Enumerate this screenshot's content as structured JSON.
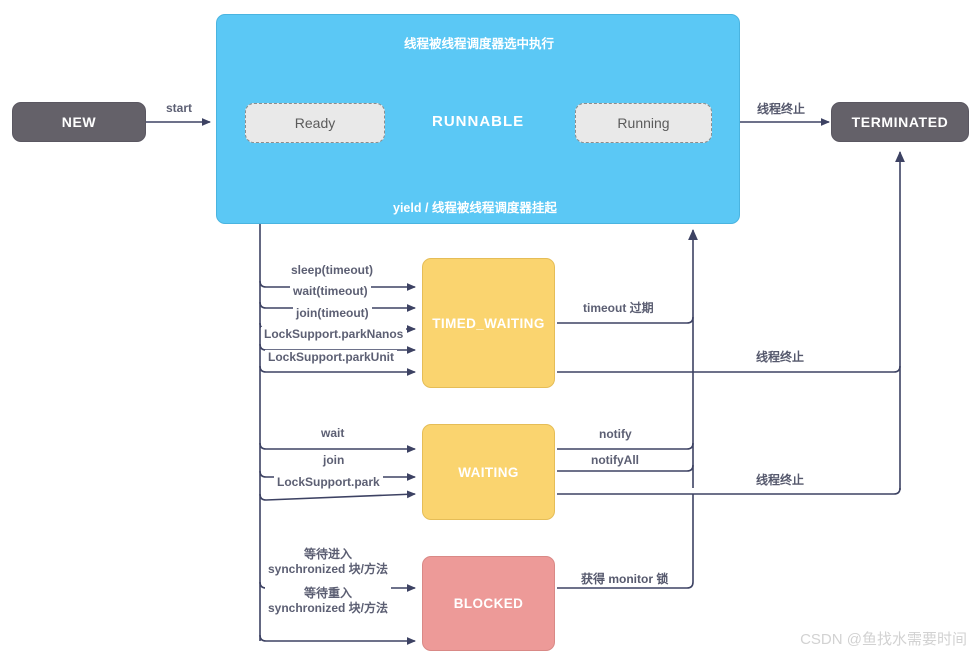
{
  "diagram": {
    "title": "Java Thread State Diagram",
    "colors": {
      "terminal": "#646169",
      "runnable": "#5BC8F5",
      "sub_state": "#e9e9e9",
      "waiting": "#FAD46F",
      "blocked": "#ED9A98",
      "edge": "#3d4263"
    }
  },
  "nodes": {
    "new": "NEW",
    "terminated": "TERMINATED",
    "runnable": "RUNNABLE",
    "ready": "Ready",
    "running": "Running",
    "timed_waiting": "TIMED_WAITING",
    "waiting": "WAITING",
    "blocked": "BLOCKED"
  },
  "runnable_band": {
    "top_label": "线程被线程调度器选中执行",
    "bottom_label": "yield / 线程被线程调度器挂起"
  },
  "edges": {
    "start": "start",
    "terminate_top": "线程终止",
    "terminate_timed": "线程终止",
    "terminate_waiting": "线程终止",
    "timed_in": [
      "sleep(timeout)",
      "wait(timeout)",
      "join(timeout)",
      "LockSupport.parkNanos",
      "LockSupport.parkUnit"
    ],
    "timed_out": "timeout 过期",
    "waiting_in": [
      "wait",
      "join",
      "LockSupport.park"
    ],
    "waiting_out": [
      "notify",
      "notifyAll"
    ],
    "blocked_in": [
      {
        "line1": "等待进入",
        "line2": "synchronized 块/方法"
      },
      {
        "line1": "等待重入",
        "line2": "synchronized 块/方法"
      }
    ],
    "blocked_out": "获得 monitor 锁"
  },
  "watermark": "CSDN @鱼找水需要时间"
}
